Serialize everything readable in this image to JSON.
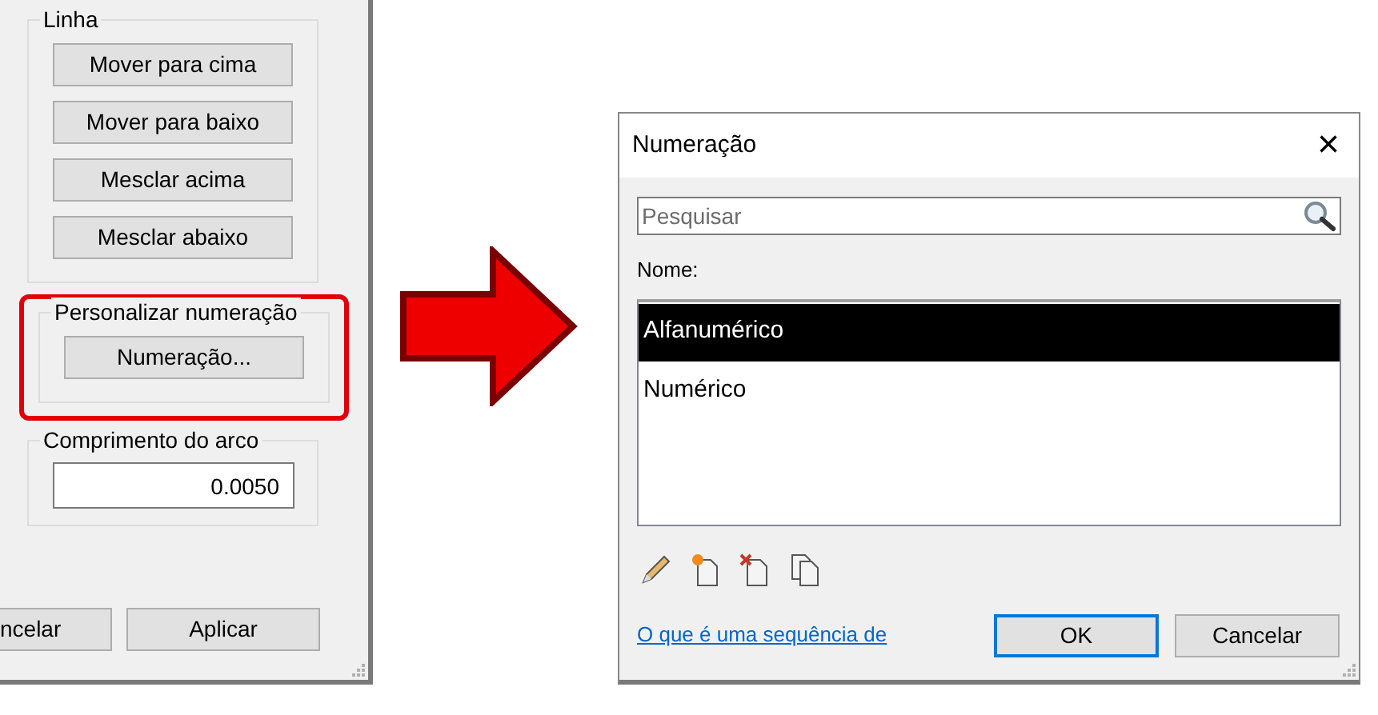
{
  "left_panel": {
    "groups": [
      {
        "kind": "buttons",
        "title": "Linha",
        "highlighted": false,
        "buttons": [
          "Mover para cima",
          "Mover para baixo",
          "Mesclar acima",
          "Mesclar abaixo"
        ]
      },
      {
        "kind": "buttons",
        "title": "Personalizar numeração",
        "highlighted": true,
        "buttons": [
          "Numeração..."
        ]
      },
      {
        "kind": "field",
        "title": "Comprimento do arco",
        "highlighted": false,
        "value": "0.0050"
      }
    ],
    "footer_buttons": [
      "ncelar",
      "Aplicar"
    ]
  },
  "dialog": {
    "title": "Numeração",
    "close": "×",
    "search": {
      "placeholder": "Pesquisar"
    },
    "list_label": "Nome:",
    "items": [
      {
        "label": "Alfanumérico",
        "selected": true
      },
      {
        "label": "Numérico",
        "selected": false
      }
    ],
    "link": "O que é uma sequência de",
    "buttons": [
      {
        "label": "OK",
        "default": true
      },
      {
        "label": "Cancelar",
        "default": false
      }
    ]
  }
}
